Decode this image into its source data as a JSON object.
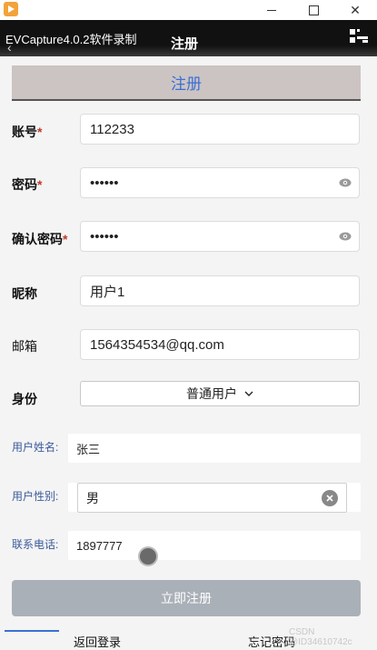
{
  "window": {
    "minimize": "",
    "maximize": "",
    "close": "✕"
  },
  "recorder": {
    "label": "EVCapture4.0.2软件录制"
  },
  "header": {
    "title": "注册"
  },
  "banner": {
    "title": "注册"
  },
  "form": {
    "account_label": "账号",
    "account_value": "112233",
    "password_label": "密码",
    "password_value": "••••••",
    "confirm_label": "确认密码",
    "confirm_value": "••••••",
    "nickname_label": "昵称",
    "nickname_value": "用户1",
    "email_label": "邮箱",
    "email_value": "1564354534@qq.com",
    "role_label": "身份",
    "role_value": "普通用户",
    "required_mark": "*"
  },
  "profile": {
    "name_label": "用户姓名:",
    "name_value": "张三",
    "gender_label": "用户性别:",
    "gender_value": "男",
    "phone_label": "联系电话:",
    "phone_value": "1897777"
  },
  "actions": {
    "submit": "立即注册",
    "back_login": "返回登录",
    "forgot_password": "忘记密码"
  },
  "watermark": "CSDN @ID34610742c",
  "colors": {
    "accent": "#3b6fd6",
    "required": "#c0392b",
    "submit_bg": "#aab0b8",
    "banner_bg": "#ccc4c2"
  }
}
